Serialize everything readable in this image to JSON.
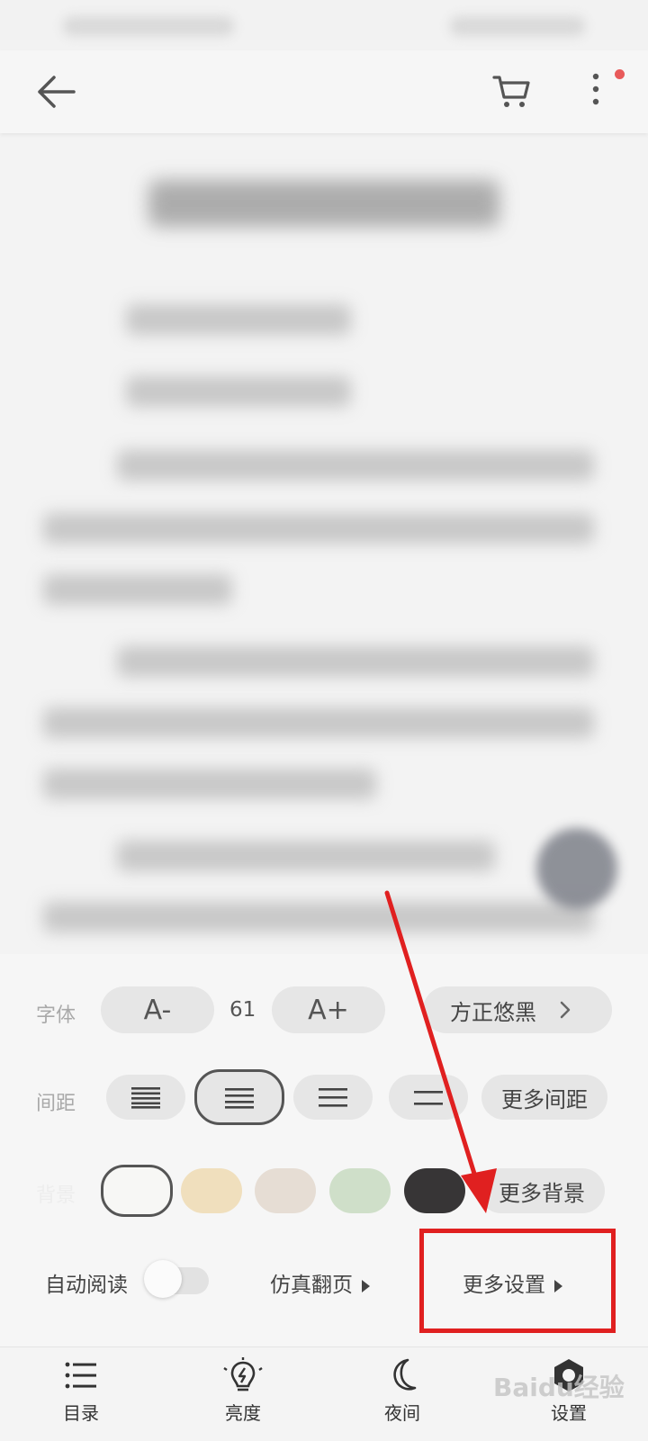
{
  "panel": {
    "font": {
      "label": "字体",
      "decrease_label": "A-",
      "size_value": "61",
      "increase_label": "A+",
      "family_label": "方正悠黑"
    },
    "spacing": {
      "label": "间距",
      "more_label": "更多间距",
      "selected_index": 1
    },
    "background": {
      "label": "背景",
      "swatches": [
        "#f7f7f5",
        "#f0dfbd",
        "#e6ddd4",
        "#cfdfc9",
        "#373536"
      ],
      "selected_index": 0,
      "more_label": "更多背景"
    },
    "auto_read_label": "自动阅读",
    "page_turn_label": "仿真翻页",
    "more_settings_label": "更多设置"
  },
  "bottom_nav": {
    "items": [
      {
        "label": "目录",
        "icon": "list-icon"
      },
      {
        "label": "亮度",
        "icon": "brightness-icon"
      },
      {
        "label": "夜间",
        "icon": "moon-icon"
      },
      {
        "label": "设置",
        "icon": "settings-icon"
      }
    ]
  },
  "colors": {
    "annotation_red": "#e02020",
    "notification_dot": "#e85a5a"
  },
  "watermark": "Baidu经验"
}
